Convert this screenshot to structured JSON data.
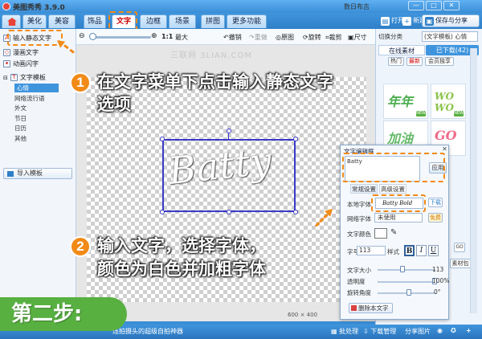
{
  "titlebar": {
    "title": "美图秀秀 3.9.0",
    "user": "数日布吉",
    "controls": [
      "—",
      "□",
      "✕"
    ]
  },
  "tabs": [
    "美化",
    "美容",
    "饰品",
    "文字",
    "边框",
    "场景",
    "拼图",
    "更多功能"
  ],
  "tabs_active": "文字",
  "top_actions": {
    "open": "打开",
    "new": "新建",
    "save_share": "保存与分享"
  },
  "left_menu": {
    "input_static": "输入静态文字",
    "trans_text": "漫画文字",
    "anim_text": "动画闪字",
    "template": "文字模板",
    "sub_items": [
      "心情",
      "网络流行语",
      "外文",
      "节日",
      "日历",
      "其他"
    ],
    "import_template": "导入模板"
  },
  "toolbar": {
    "zoom_ratio": "1:1",
    "max": "最大",
    "undo": "撤销",
    "redo": "重做",
    "original": "原图",
    "rotate": "旋转",
    "crop": "裁剪",
    "size": "尺寸"
  },
  "canvas": {
    "text": "Batty",
    "size": "600 × 400",
    "watermark": "三联网 3LIAN.COM"
  },
  "right_panel": {
    "category_label": "切换分类",
    "category_value": "(文字模板) 心情",
    "tab_online": "在线素材",
    "tab_downloaded": "已下载(42)",
    "chips": [
      "热门",
      "最新",
      "会员独享"
    ],
    "thumbs": [
      {
        "text": "年年",
        "color": "#4caf50"
      },
      {
        "text": "WO WO",
        "color": "#8bc34a"
      },
      {
        "text": "加油",
        "color": "#66bb6a"
      },
      {
        "text": "GO",
        "color": "#ef6c8a"
      }
    ],
    "new_badge": "NEW",
    "go_btn": "GO",
    "material_pack": "素材包"
  },
  "dialog": {
    "title": "文字编辑框",
    "close": "✕",
    "input_text": "Batty",
    "apply": "应用",
    "tab_regular": "常规设置",
    "tab_advanced": "高级设置",
    "local_font_label": "本地字体",
    "font_sample": "Batty Bold",
    "download": "下载",
    "net_font_label": "网络字体",
    "net_font_value": "未使用",
    "free": "免费",
    "color_label": "文字颜色",
    "size_label": "字号",
    "size_value": "113",
    "style_label": "样式",
    "bold": "B",
    "italic": "I",
    "underline": "U",
    "text_size_label": "文字大小",
    "text_size_value": "113",
    "opacity_label": "透明度",
    "opacity_value": "100%",
    "rotate_label": "旋转角度",
    "rotate_value": "0°",
    "delete_text": "删除本文字"
  },
  "callouts": {
    "step1_number": "1",
    "step1_line1": "在文字菜单下点击输入静态文字",
    "step1_line2": "选项",
    "step2_number": "2",
    "step2_line1": "输入文字，选择字体，",
    "step2_line2": "颜色为白色并加粗字体",
    "step_badge": "第二步:"
  },
  "statusbar": {
    "ad": "连拍摄头的超级自拍神器",
    "batch": "批处理",
    "download_mgr": "下载管理",
    "share": "分享图片"
  },
  "colors": {
    "accent": "#3f95dd",
    "highlight": "#f18a17",
    "step_badge": "#58b041"
  }
}
